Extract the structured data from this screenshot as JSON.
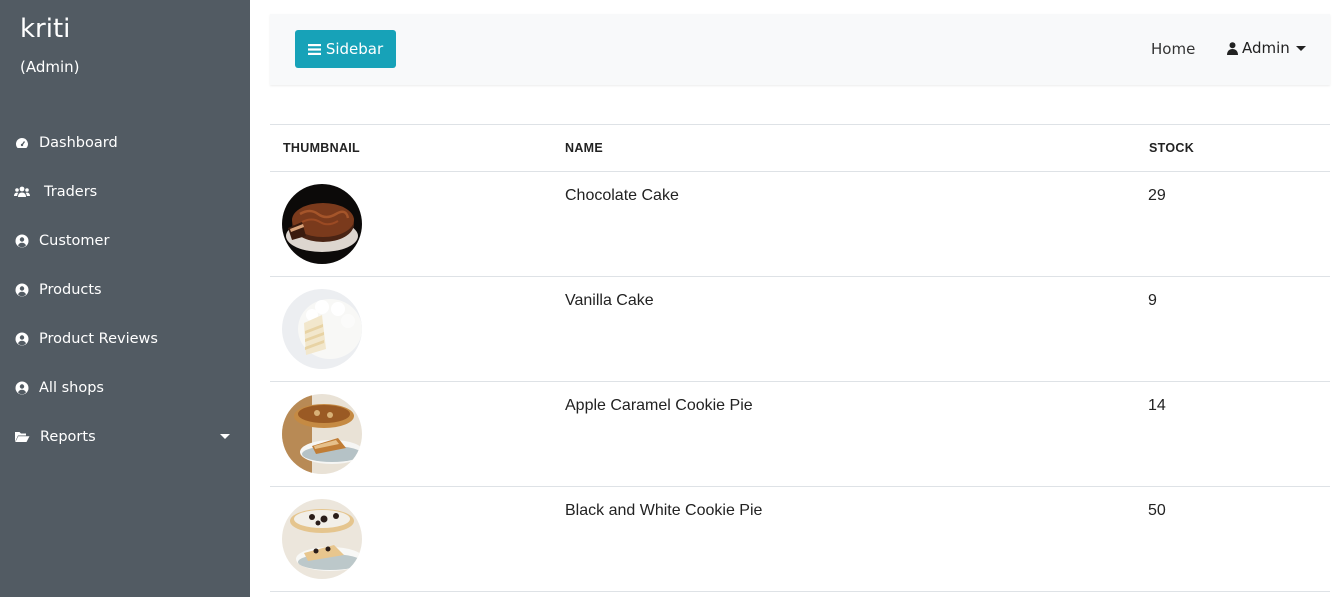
{
  "sidebar": {
    "title": "kriti",
    "subtitle": "(Admin)",
    "items": [
      {
        "label": "Dashboard",
        "icon": "dashboard-icon"
      },
      {
        "label": "Traders",
        "icon": "users-icon"
      },
      {
        "label": "Customer",
        "icon": "user-circle-icon"
      },
      {
        "label": "Products",
        "icon": "user-circle-icon"
      },
      {
        "label": "Product Reviews",
        "icon": "user-circle-icon"
      },
      {
        "label": "All shops",
        "icon": "user-circle-icon"
      },
      {
        "label": "Reports",
        "icon": "folder-open-icon"
      }
    ]
  },
  "topbar": {
    "sidebar_button": "Sidebar",
    "home": "Home",
    "admin": "Admin"
  },
  "table": {
    "headers": {
      "thumbnail": "THUMBNAIL",
      "name": "NAME",
      "stock": "STOCK"
    },
    "rows": [
      {
        "name": "Chocolate Cake",
        "stock": "29"
      },
      {
        "name": "Vanilla Cake",
        "stock": "9"
      },
      {
        "name": "Apple Caramel Cookie Pie",
        "stock": "14"
      },
      {
        "name": "Black and White Cookie Pie",
        "stock": "50"
      }
    ]
  },
  "colors": {
    "sidebar_bg": "#525b63",
    "accent": "#17a2b8",
    "topbar_bg": "#f8f9fa"
  }
}
